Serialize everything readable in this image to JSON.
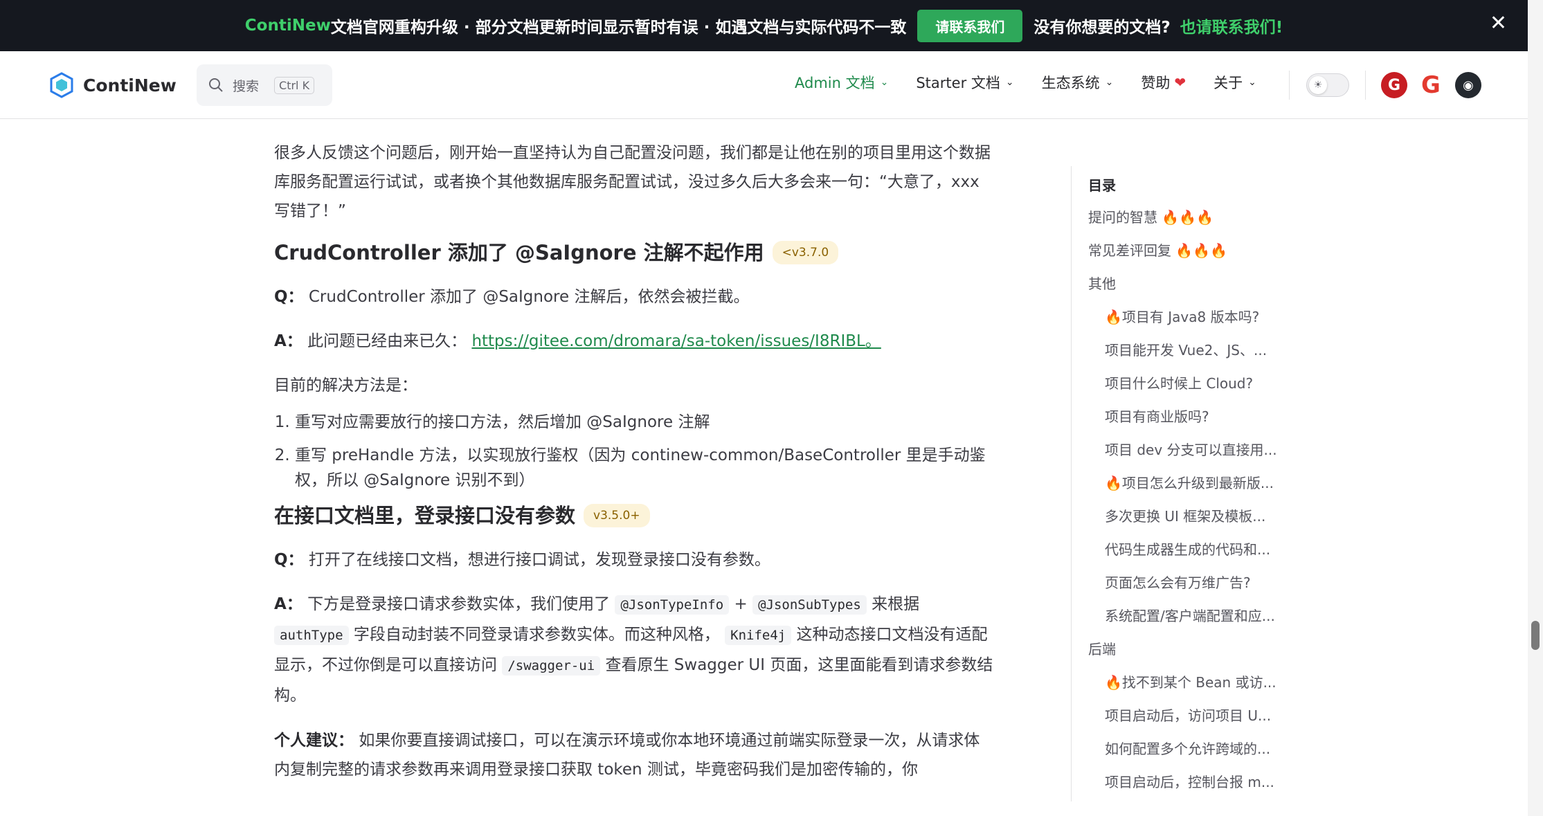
{
  "banner": {
    "brand": "ContiNew",
    "text": " 文档官网重构升级 · 部分文档更新时间显示暂时有误 · 如遇文档与实际代码不一致",
    "button": "请联系我们",
    "question": "没有你想要的文档?",
    "contact": "也请联系我们!",
    "close": "✕"
  },
  "nav": {
    "logo_text": "ContiNew",
    "search_placeholder": "搜索",
    "search_kbd": "Ctrl K",
    "menu": [
      {
        "label": "Admin 文档"
      },
      {
        "label": "Starter 文档"
      },
      {
        "label": "生态系统"
      },
      {
        "label": "赞助"
      },
      {
        "label": "关于"
      }
    ],
    "chevron": "⌄",
    "heart": "❤",
    "sun": "☀",
    "github_glyph": "◉",
    "gitee_glyph": "G",
    "gcode_glyph": "G"
  },
  "article": {
    "intro": "很多人反馈这个问题后，刚开始一直坚持认为自己配置没问题，我们都是让他在别的项目里用这个数据库服务配置运行试试，或者换个其他数据库服务配置试试，没过多久后大多会来一句：“大意了，xxx写错了！”",
    "s1": {
      "title": "CrudController 添加了 @SaIgnore 注解不起作用",
      "badge": "<v3.7.0",
      "q_label": "Q：",
      "q": "CrudController 添加了 @SaIgnore 注解后，依然会被拦截。",
      "a_label": "A：",
      "a": "此问题已经由来已久：",
      "link": "https://gitee.com/dromara/sa-token/issues/I8RIBL。",
      "solution": "目前的解决方法是：",
      "items": [
        "重写对应需要放行的接口方法，然后增加 @SaIgnore 注解",
        "重写 preHandle 方法，以实现放行鉴权（因为 continew-common/BaseController 里是手动鉴权，所以 @SaIgnore 识别不到）"
      ]
    },
    "s2": {
      "title": "在接口文档里，登录接口没有参数",
      "badge": "v3.5.0+",
      "q_label": "Q：",
      "q": "打开了在线接口文档，想进行接口调试，发现登录接口没有参数。",
      "a_label": "A：",
      "a1": "下方是登录接口请求参数实体，我们使用了",
      "code1": "@JsonTypeInfo",
      "plus": " + ",
      "code2": "@JsonSubTypes",
      "a2": "来根据",
      "code3": "authType",
      "a3": "字段自动封装不同登录请求参数实体。而这种风格，",
      "code4": "Knife4j",
      "a4": "这种动态接口文档没有适配显示，不过你倒是可以直接访问",
      "code5": "/swagger-ui",
      "a5": "查看原生 Swagger UI 页面，这里面能看到请求参数结构。",
      "tip_label": "个人建议：",
      "tip": "如果你要直接调试接口，可以在演示环境或你本地环境通过前端实际登录一次，从请求体内复制完整的请求参数再来调用登录接口获取 token 测试，毕竟密码我们是加密传输的，你"
    }
  },
  "outline": {
    "title": "目录",
    "items": [
      {
        "label": "提问的智慧 🔥🔥🔥"
      },
      {
        "label": "常见差评回复 🔥🔥🔥"
      },
      {
        "label": "其他"
      },
      {
        "label": "🔥项目有 Java8 版本吗?"
      },
      {
        "label": "项目能开发 Vue2、JS、..."
      },
      {
        "label": "项目什么时候上 Cloud?"
      },
      {
        "label": "项目有商业版吗?"
      },
      {
        "label": "项目 dev 分支可以直接用..."
      },
      {
        "label": "🔥项目怎么升级到最新版..."
      },
      {
        "label": "多次更换 UI 框架及模板..."
      },
      {
        "label": "代码生成器生成的代码和..."
      },
      {
        "label": "页面怎么会有万维广告?"
      },
      {
        "label": "系统配置/客户端配置和应..."
      },
      {
        "label": "后端"
      },
      {
        "label": "🔥找不到某个 Bean 或访..."
      },
      {
        "label": "项目启动后，访问项目 U..."
      },
      {
        "label": "如何配置多个允许跨域的..."
      },
      {
        "label": "项目启动后，控制台报 m..."
      }
    ]
  }
}
